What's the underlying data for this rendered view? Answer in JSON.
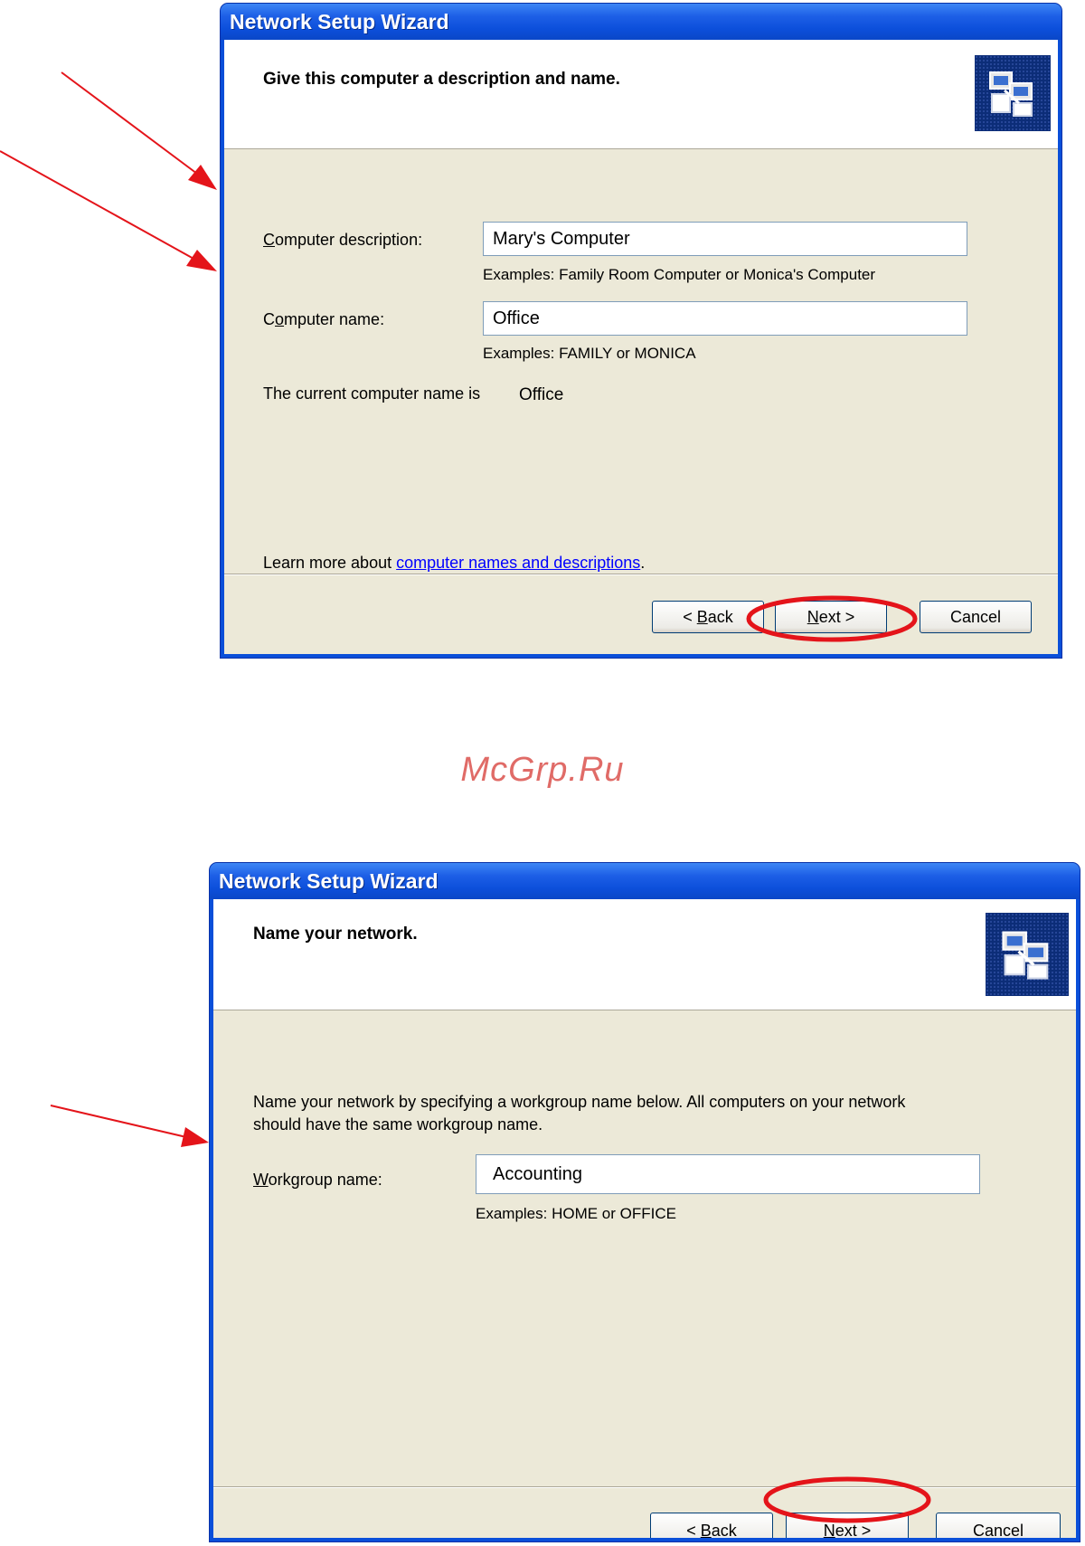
{
  "dialog1": {
    "title": "Network Setup Wizard",
    "heading": "Give this computer a description and name.",
    "description_label_pre": "",
    "description_label_key": "C",
    "description_label_post": "omputer description:",
    "description_value": "Mary's Computer",
    "description_hint": "Examples: Family Room Computer or Monica's Computer",
    "name_label_key": "o",
    "name_label_pre": "C",
    "name_label_post": "mputer name:",
    "name_value": "Office",
    "name_hint": "Examples: FAMILY or MONICA",
    "current_name_label": "The current computer name is",
    "current_name_value": "Office",
    "learn_more_prefix": "Learn more about",
    "learn_more_link": "computer names and descriptions",
    "learn_more_suffix": ".",
    "back_button": {
      "pre": "< ",
      "key": "B",
      "post": "ack"
    },
    "next_button": {
      "key": "N",
      "post": "ext >"
    },
    "cancel_button": "Cancel"
  },
  "watermark": "McGrp.Ru",
  "dialog2": {
    "title": "Network Setup Wizard",
    "heading": "Name your network.",
    "intro_line1": "Name your network by specifying a workgroup name below. All computers on your network",
    "intro_line2": "should have the same workgroup name.",
    "workgroup_label_key": "W",
    "workgroup_label_post": "orkgroup name:",
    "workgroup_value": "Accounting",
    "workgroup_hint": "Examples: HOME or OFFICE",
    "back_button": {
      "pre": "< ",
      "key": "B",
      "post": "ack"
    },
    "next_button": {
      "key": "N",
      "post": "ext >"
    },
    "cancel_button": "Cancel"
  },
  "colors": {
    "annotation_red": "#e4141a",
    "titlebar_blue": "#0a4fd9",
    "dialog_face": "#ece9d8",
    "link_blue": "#0000ff",
    "watermark": "#e06b67"
  },
  "icons": [
    "network-computers-icon",
    "red-arrow-icon",
    "red-highlight-ellipse-icon"
  ]
}
